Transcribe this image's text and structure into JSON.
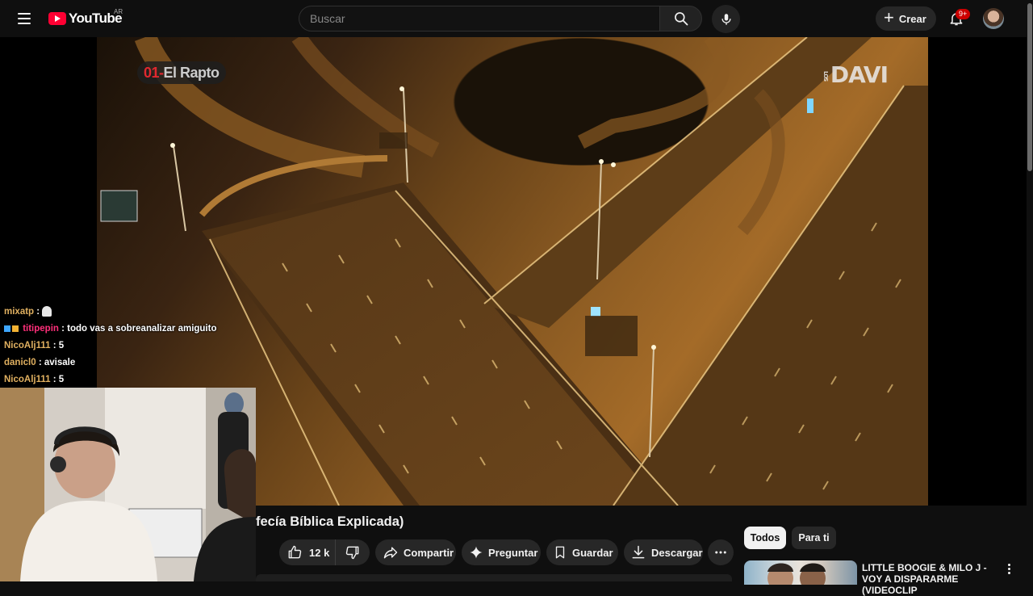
{
  "header": {
    "logo_text": "YouTube",
    "country_code": "AR",
    "search_placeholder": "Buscar",
    "create_label": "Crear",
    "notification_count": "9+",
    "icons": [
      "menu-icon",
      "youtube-logo",
      "search-icon",
      "microphone-icon",
      "plus-icon",
      "bell-icon",
      "avatar"
    ]
  },
  "player": {
    "episode_number": "01",
    "episode_title": "El Rapto",
    "channel_watermark": "DAVI",
    "channel_watermark_prefix": "LOS"
  },
  "chat": [
    {
      "user": "mixatp",
      "message": "",
      "user_color": "#e0b060",
      "badges": [],
      "emote": "ghost-emote"
    },
    {
      "user": "titipepin",
      "message": "todo vas a sobreanalizar amiguito",
      "user_color": "#ff2f7a",
      "badges": [
        "cube-badge",
        "gift-badge"
      ]
    },
    {
      "user": "NicoAlj111",
      "message": "5",
      "user_color": "#e0b060",
      "badges": []
    },
    {
      "user": "danicl0",
      "message": "avisale",
      "user_color": "#e0b060",
      "badges": []
    },
    {
      "user": "NicoAlj111",
      "message": "5",
      "user_color": "#e0b060",
      "badges": []
    }
  ],
  "video": {
    "title_visible": "fecía Bíblica Explicada)",
    "like_count": "12 k",
    "share_label": "Compartir",
    "ask_label": "Preguntar",
    "save_label": "Guardar",
    "download_label": "Descargar"
  },
  "filter_chips": [
    {
      "label": "Todos",
      "active": true
    },
    {
      "label": "Para ti",
      "active": false
    }
  ],
  "recommendations": [
    {
      "title": "LITTLE BOOGIE & MILO J - VOY A DISPARARME (VIDEOCLIP"
    }
  ],
  "colors": {
    "background": "#0f0f0f",
    "brand_red": "#ff0033",
    "chip_active_bg": "#f1f1f1",
    "button_bg": "#272727"
  }
}
